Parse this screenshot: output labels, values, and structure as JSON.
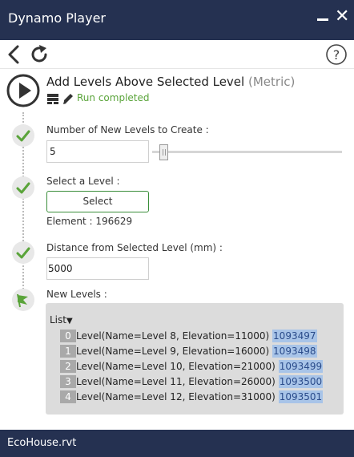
{
  "window": {
    "title": "Dynamo Player"
  },
  "toolbar": {
    "help_label": "?"
  },
  "graph": {
    "title": "Add Levels Above Selected Level",
    "title_suffix": "(Metric)",
    "status": "Run completed"
  },
  "inputs": {
    "levels": {
      "label": "Number of New Levels to Create :",
      "value": "5",
      "slider_fraction": 0.05
    },
    "level": {
      "label": "Select a Level :",
      "button_label": "Select",
      "element": "Element : 196629"
    },
    "distance": {
      "label": "Distance from Selected Level (mm) :",
      "value": "5000"
    }
  },
  "output": {
    "label": "New Levels :",
    "list_label": "List",
    "items": [
      {
        "index": "0",
        "value": "Level(Name=Level 8, Elevation=11000)",
        "id": "1093497"
      },
      {
        "index": "1",
        "value": "Level(Name=Level 9, Elevation=16000)",
        "id": "1093498"
      },
      {
        "index": "2",
        "value": "Level(Name=Level 10, Elevation=21000)",
        "id": "1093499"
      },
      {
        "index": "3",
        "value": "Level(Name=Level 11, Elevation=26000)",
        "id": "1093500"
      },
      {
        "index": "4",
        "value": "Level(Name=Level 12, Elevation=31000)",
        "id": "1093501"
      }
    ]
  },
  "statusbar": {
    "file": "EcoHouse.rvt"
  },
  "colors": {
    "titlebar": "#253151",
    "success": "#5aa43a",
    "accent_green": "#3a8e3a",
    "id_highlight": "#a8c4e8"
  },
  "icons": [
    "minimize-icon",
    "close-icon",
    "back-arrow-icon",
    "refresh-icon",
    "help-icon",
    "play-icon",
    "graph-icon",
    "edit-icon",
    "check-icon",
    "flag-icon"
  ]
}
